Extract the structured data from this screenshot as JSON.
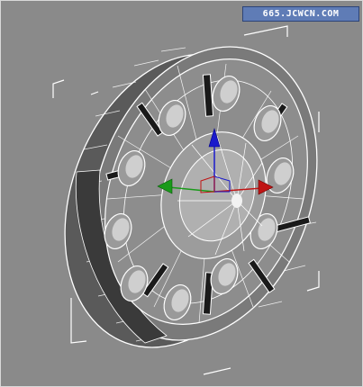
{
  "viewport": {
    "name": "perspective-viewport",
    "background": "#8a8a8a",
    "wireframe_color": "#ffffff",
    "shaded_color": "#6f6f6f"
  },
  "watermark": {
    "text": "665.JCWCN.COM",
    "background": "#5f7cb6"
  },
  "gizmo": {
    "x_axis_color": "#c01515",
    "y_axis_color": "#1a9a1a",
    "z_axis_color": "#1a1acc"
  },
  "object": {
    "type": "wheel-rim",
    "hole_count": 10,
    "slot_count": 8
  }
}
